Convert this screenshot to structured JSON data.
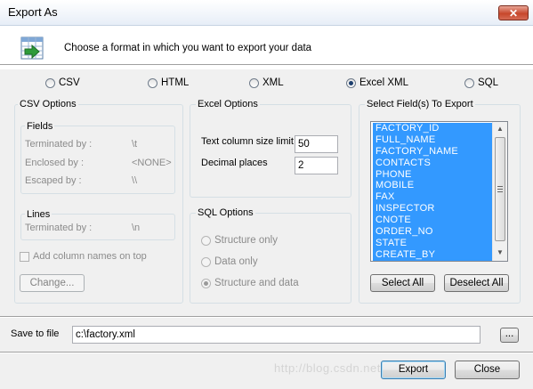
{
  "window": {
    "title": "Export As",
    "close_glyph": "✕"
  },
  "header": {
    "prompt": "Choose a format in which you want to export your data",
    "icon": "spreadsheet-export-icon"
  },
  "formats": [
    {
      "label": "CSV",
      "selected": false
    },
    {
      "label": "HTML",
      "selected": false
    },
    {
      "label": "XML",
      "selected": false
    },
    {
      "label": "Excel XML",
      "selected": true
    },
    {
      "label": "SQL",
      "selected": false
    }
  ],
  "csv_options": {
    "title": "CSV Options",
    "fields_title": "Fields",
    "terminated_label": "Terminated by :",
    "terminated_value": "\\t",
    "enclosed_label": "Enclosed by :",
    "enclosed_value": "<NONE>",
    "escaped_label": "Escaped by :",
    "escaped_value": "\\\\",
    "lines_title": "Lines",
    "lines_terminated_label": "Terminated by :",
    "lines_terminated_value": "\\n",
    "add_column_names_label": "Add column names on top",
    "change_button": "Change..."
  },
  "excel_options": {
    "title": "Excel Options",
    "text_col_label": "Text column size limit",
    "text_col_value": "50",
    "decimal_label": "Decimal places",
    "decimal_value": "2"
  },
  "sql_options": {
    "title": "SQL Options",
    "structure_only": "Structure only",
    "data_only": "Data only",
    "structure_and_data": "Structure and data",
    "selected": "structure_and_data"
  },
  "fields_panel": {
    "title": "Select Field(s) To Export",
    "items": [
      "FACTORY_ID",
      "FULL_NAME",
      "FACTORY_NAME",
      "CONTACTS",
      "PHONE",
      "MOBILE",
      "FAX",
      "INSPECTOR",
      "CNOTE",
      "ORDER_NO",
      "STATE",
      "CREATE_BY"
    ],
    "select_all": "Select All",
    "deselect_all": "Deselect All"
  },
  "save": {
    "label": "Save to file",
    "value": "c:\\factory.xml",
    "browse": "..."
  },
  "footer": {
    "export": "Export",
    "close": "Close",
    "watermark": "http://blog.csdn.net/CSDN AI"
  },
  "colors": {
    "selection": "#3399ff",
    "title_close": "#c7472b"
  }
}
